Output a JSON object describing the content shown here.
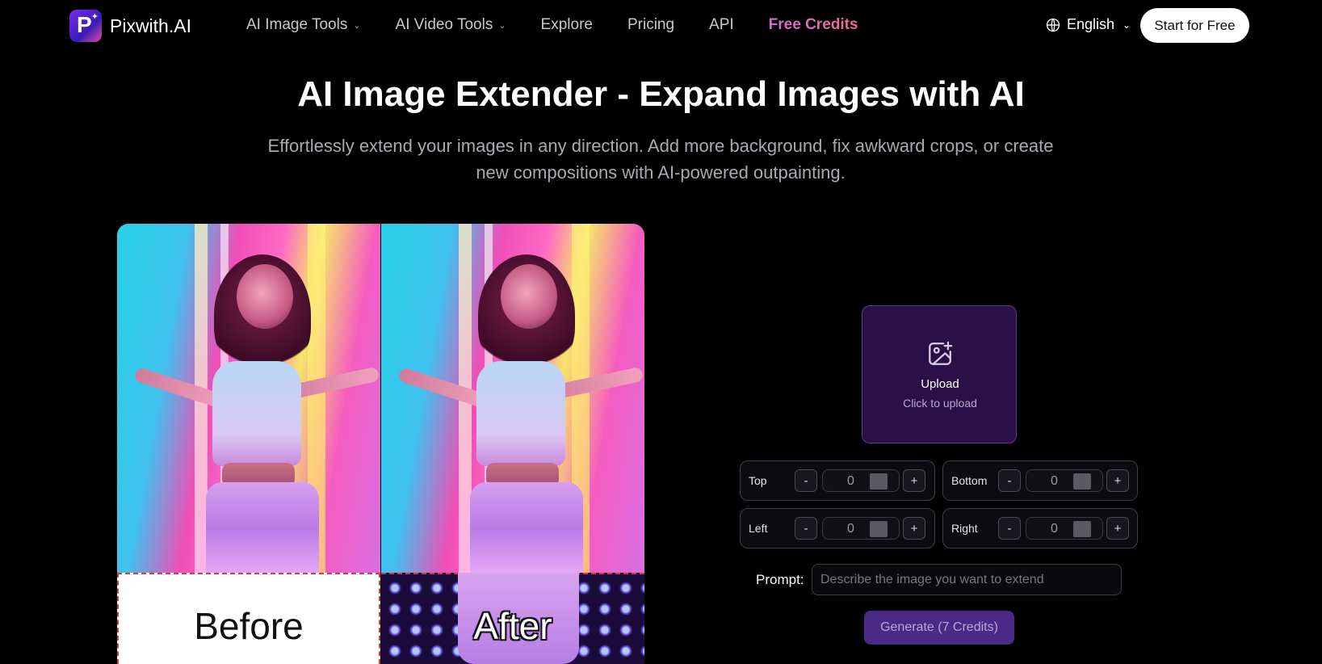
{
  "nav": {
    "logo_text": "Pixwith.AI",
    "items": [
      {
        "label": "AI Image Tools",
        "has_dropdown": true
      },
      {
        "label": "AI Video Tools",
        "has_dropdown": true
      },
      {
        "label": "Explore",
        "has_dropdown": false
      },
      {
        "label": "Pricing",
        "has_dropdown": false
      },
      {
        "label": "API",
        "has_dropdown": false
      },
      {
        "label": "Free Credits",
        "has_dropdown": false
      }
    ],
    "language": "English",
    "cta": "Start for Free"
  },
  "hero": {
    "title": "AI Image Extender - Expand Images with AI",
    "subtitle": "Effortlessly extend your images in any direction. Add more background, fix awkward crops, or create new compositions with AI-powered outpainting."
  },
  "demo": {
    "before_label": "Before",
    "after_label": "After"
  },
  "upload": {
    "title": "Upload",
    "subtitle": "Click to upload"
  },
  "controls": {
    "top": {
      "label": "Top",
      "value": "0"
    },
    "bottom": {
      "label": "Bottom",
      "value": "0"
    },
    "left": {
      "label": "Left",
      "value": "0"
    },
    "right": {
      "label": "Right",
      "value": "0"
    },
    "minus": "-",
    "plus": "+"
  },
  "prompt": {
    "label": "Prompt:",
    "placeholder": "Describe the image you want to extend"
  },
  "generate_label": "Generate (7 Credits)",
  "colors": {
    "background": "#000000",
    "upload_bg": "#2b0f47",
    "generate_bg": "#4a2a86",
    "credits_gradient": [
      "#d86bd8",
      "#f06a8a"
    ]
  }
}
